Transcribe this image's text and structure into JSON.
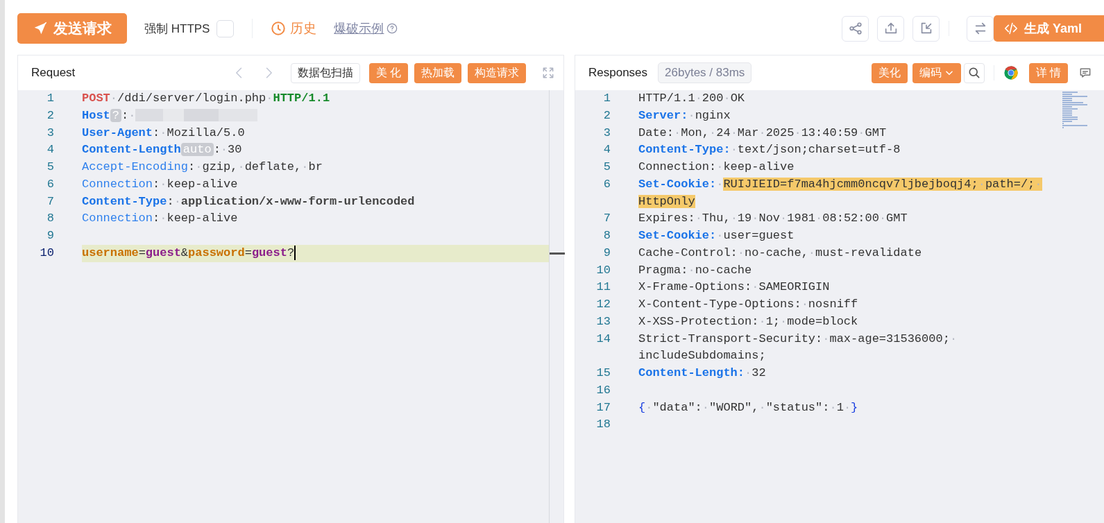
{
  "toolbar": {
    "send_button": "发送请求",
    "force_https": {
      "label": "强制 HTTPS",
      "checked": false
    },
    "history_link": "历史",
    "example_link": "爆破示例",
    "generate_button": "生成 Yaml"
  },
  "request": {
    "title": "Request",
    "buttons": [
      {
        "label": "数据包扫描",
        "kind": "outline"
      },
      {
        "label": "美 化",
        "kind": "primary"
      },
      {
        "label": "热加载",
        "kind": "primary"
      },
      {
        "label": "构造请求",
        "kind": "primary"
      }
    ],
    "lines": [
      {
        "number": "1",
        "current": false,
        "tokens": [
          {
            "kind": "method",
            "text": "POST"
          },
          {
            "kind": "ws",
            "text": "·"
          },
          {
            "kind": "text",
            "text": "/ddi/server/login.php"
          },
          {
            "kind": "ws",
            "text": "·"
          },
          {
            "kind": "version",
            "text": "HTTP/1.1"
          }
        ]
      },
      {
        "number": "2",
        "current": false,
        "tokens": [
          {
            "kind": "key",
            "text": "Host"
          },
          {
            "kind": "tag",
            "text": "?"
          },
          {
            "kind": "text",
            "text": ":"
          },
          {
            "kind": "ws",
            "text": "·"
          },
          {
            "kind": "redacted"
          }
        ]
      },
      {
        "number": "3",
        "current": false,
        "tokens": [
          {
            "kind": "key",
            "text": "User-Agent"
          },
          {
            "kind": "text",
            "text": ":"
          },
          {
            "kind": "ws",
            "text": "·"
          },
          {
            "kind": "text",
            "text": "Mozilla/5.0"
          }
        ]
      },
      {
        "number": "4",
        "current": false,
        "tokens": [
          {
            "kind": "key",
            "text": "Content-Length"
          },
          {
            "kind": "tag",
            "text": "auto"
          },
          {
            "kind": "text",
            "text": ":"
          },
          {
            "kind": "ws",
            "text": "·"
          },
          {
            "kind": "text",
            "text": "30"
          }
        ]
      },
      {
        "number": "5",
        "current": false,
        "tokens": [
          {
            "kind": "key-light",
            "text": "Accept-Encoding"
          },
          {
            "kind": "text",
            "text": ":"
          },
          {
            "kind": "ws",
            "text": "·"
          },
          {
            "kind": "text",
            "text": "gzip,"
          },
          {
            "kind": "ws",
            "text": "·"
          },
          {
            "kind": "text",
            "text": "deflate,"
          },
          {
            "kind": "ws",
            "text": "·"
          },
          {
            "kind": "text",
            "text": "br"
          }
        ]
      },
      {
        "number": "6",
        "current": false,
        "tokens": [
          {
            "kind": "key-light",
            "text": "Connection"
          },
          {
            "kind": "text",
            "text": ":"
          },
          {
            "kind": "ws",
            "text": "·"
          },
          {
            "kind": "text",
            "text": "keep-alive"
          }
        ]
      },
      {
        "number": "7",
        "current": false,
        "tokens": [
          {
            "kind": "key",
            "text": "Content-Type"
          },
          {
            "kind": "text",
            "text": ":"
          },
          {
            "kind": "ws",
            "text": "·"
          },
          {
            "kind": "strong",
            "text": "application/x-www-form-urlencoded"
          }
        ]
      },
      {
        "number": "8",
        "current": false,
        "tokens": [
          {
            "kind": "key-light",
            "text": "Connection"
          },
          {
            "kind": "text",
            "text": ":"
          },
          {
            "kind": "ws",
            "text": "·"
          },
          {
            "kind": "text",
            "text": "keep-alive"
          }
        ]
      },
      {
        "number": "9",
        "current": false
      },
      {
        "number": "10",
        "current": true,
        "tokens": [
          {
            "kind": "param",
            "text": "username"
          },
          {
            "kind": "text",
            "text": "="
          },
          {
            "kind": "param-value",
            "text": "guest"
          },
          {
            "kind": "text",
            "text": "&"
          },
          {
            "kind": "param",
            "text": "password"
          },
          {
            "kind": "text",
            "text": "="
          },
          {
            "kind": "param-value",
            "text": "guest"
          },
          {
            "kind": "text",
            "text": "?"
          },
          {
            "kind": "cursor"
          }
        ]
      }
    ]
  },
  "response": {
    "title": "Responses",
    "stats": "26bytes / 83ms",
    "buttons": [
      {
        "label": "美化",
        "kind": "primary"
      },
      {
        "label": "编码",
        "kind": "dropdown"
      },
      {
        "kind": "search"
      },
      {
        "kind": "browser"
      },
      {
        "label": "详 情",
        "kind": "primary"
      },
      {
        "kind": "comment"
      }
    ],
    "lines": [
      {
        "number": "1",
        "tokens": [
          {
            "kind": "text",
            "text": "HTTP/1.1"
          },
          {
            "kind": "ws",
            "text": "·"
          },
          {
            "kind": "text",
            "text": "200"
          },
          {
            "kind": "ws",
            "text": "·"
          },
          {
            "kind": "text",
            "text": "OK"
          }
        ]
      },
      {
        "number": "2",
        "tokens": [
          {
            "kind": "key",
            "text": "Server:"
          },
          {
            "kind": "ws",
            "text": "·"
          },
          {
            "kind": "text",
            "text": "nginx"
          }
        ]
      },
      {
        "number": "3",
        "tokens": [
          {
            "kind": "text",
            "text": "Date:"
          },
          {
            "kind": "ws",
            "text": "·"
          },
          {
            "kind": "text",
            "text": "Mon,"
          },
          {
            "kind": "ws",
            "text": "·"
          },
          {
            "kind": "text",
            "text": "24"
          },
          {
            "kind": "ws",
            "text": "·"
          },
          {
            "kind": "text",
            "text": "Mar"
          },
          {
            "kind": "ws",
            "text": "·"
          },
          {
            "kind": "text",
            "text": "2025"
          },
          {
            "kind": "ws",
            "text": "·"
          },
          {
            "kind": "text",
            "text": "13:40:59"
          },
          {
            "kind": "ws",
            "text": "·"
          },
          {
            "kind": "text",
            "text": "GMT"
          }
        ]
      },
      {
        "number": "4",
        "tokens": [
          {
            "kind": "key",
            "text": "Content-Type:"
          },
          {
            "kind": "ws",
            "text": "·"
          },
          {
            "kind": "text",
            "text": "text/json;charset=utf-8"
          }
        ]
      },
      {
        "number": "5",
        "tokens": [
          {
            "kind": "text",
            "text": "Connection:"
          },
          {
            "kind": "ws",
            "text": "·"
          },
          {
            "kind": "text",
            "text": "keep-alive"
          }
        ]
      },
      {
        "number": "6",
        "tokens": [
          {
            "kind": "key",
            "text": "Set-Cookie:"
          },
          {
            "kind": "ws",
            "text": "·"
          },
          {
            "kind": "mark",
            "text": "RUIJIEID=f7ma4hjcmm0ncqv7ljbejboqj4;"
          },
          {
            "kind": "mark-ws",
            "text": "·"
          },
          {
            "kind": "mark",
            "text": "path=/;"
          },
          {
            "kind": "mark-ws",
            "text": "·"
          },
          {
            "kind": "mark",
            "text": "HttpOnly"
          }
        ]
      },
      {
        "number": "7",
        "tokens": [
          {
            "kind": "text",
            "text": "Expires:"
          },
          {
            "kind": "ws",
            "text": "·"
          },
          {
            "kind": "text",
            "text": "Thu,"
          },
          {
            "kind": "ws",
            "text": "·"
          },
          {
            "kind": "text",
            "text": "19"
          },
          {
            "kind": "ws",
            "text": "·"
          },
          {
            "kind": "text",
            "text": "Nov"
          },
          {
            "kind": "ws",
            "text": "·"
          },
          {
            "kind": "text",
            "text": "1981"
          },
          {
            "kind": "ws",
            "text": "·"
          },
          {
            "kind": "text",
            "text": "08:52:00"
          },
          {
            "kind": "ws",
            "text": "·"
          },
          {
            "kind": "text",
            "text": "GMT"
          }
        ]
      },
      {
        "number": "8",
        "tokens": [
          {
            "kind": "key",
            "text": "Set-Cookie:"
          },
          {
            "kind": "ws",
            "text": "·"
          },
          {
            "kind": "text",
            "text": "user=guest"
          }
        ]
      },
      {
        "number": "9",
        "tokens": [
          {
            "kind": "text",
            "text": "Cache-Control:"
          },
          {
            "kind": "ws",
            "text": "·"
          },
          {
            "kind": "text",
            "text": "no-cache,"
          },
          {
            "kind": "ws",
            "text": "·"
          },
          {
            "kind": "text",
            "text": "must-revalidate"
          }
        ]
      },
      {
        "number": "10",
        "tokens": [
          {
            "kind": "text",
            "text": "Pragma:"
          },
          {
            "kind": "ws",
            "text": "·"
          },
          {
            "kind": "text",
            "text": "no-cache"
          }
        ]
      },
      {
        "number": "11",
        "tokens": [
          {
            "kind": "text",
            "text": "X-Frame-Options:"
          },
          {
            "kind": "ws",
            "text": "·"
          },
          {
            "kind": "text",
            "text": "SAMEORIGIN"
          }
        ]
      },
      {
        "number": "12",
        "tokens": [
          {
            "kind": "text",
            "text": "X-Content-Type-Options:"
          },
          {
            "kind": "ws",
            "text": "·"
          },
          {
            "kind": "text",
            "text": "nosniff"
          }
        ]
      },
      {
        "number": "13",
        "tokens": [
          {
            "kind": "text",
            "text": "X-XSS-Protection:"
          },
          {
            "kind": "ws",
            "text": "·"
          },
          {
            "kind": "text",
            "text": "1;"
          },
          {
            "kind": "ws",
            "text": "·"
          },
          {
            "kind": "text",
            "text": "mode=block"
          }
        ]
      },
      {
        "number": "14",
        "tokens": [
          {
            "kind": "text",
            "text": "Strict-Transport-Security:"
          },
          {
            "kind": "ws",
            "text": "·"
          },
          {
            "kind": "text",
            "text": "max-age=31536000;"
          },
          {
            "kind": "ws",
            "text": "·"
          },
          {
            "kind": "text",
            "text": "includeSubdomains;"
          }
        ]
      },
      {
        "number": "15",
        "tokens": [
          {
            "kind": "key",
            "text": "Content-Length:"
          },
          {
            "kind": "ws",
            "text": "·"
          },
          {
            "kind": "text",
            "text": "32"
          }
        ]
      },
      {
        "number": "16"
      },
      {
        "number": "17",
        "tokens": [
          {
            "kind": "brace",
            "text": "{"
          },
          {
            "kind": "ws",
            "text": "·"
          },
          {
            "kind": "text",
            "text": "\"data\":"
          },
          {
            "kind": "ws",
            "text": "·"
          },
          {
            "kind": "text",
            "text": "\"WORD\","
          },
          {
            "kind": "ws",
            "text": "·"
          },
          {
            "kind": "text",
            "text": "\"status\":"
          },
          {
            "kind": "ws",
            "text": "·"
          },
          {
            "kind": "text",
            "text": "1"
          },
          {
            "kind": "ws",
            "text": "·"
          },
          {
            "kind": "brace",
            "text": "}"
          }
        ]
      },
      {
        "number": "18"
      }
    ]
  }
}
